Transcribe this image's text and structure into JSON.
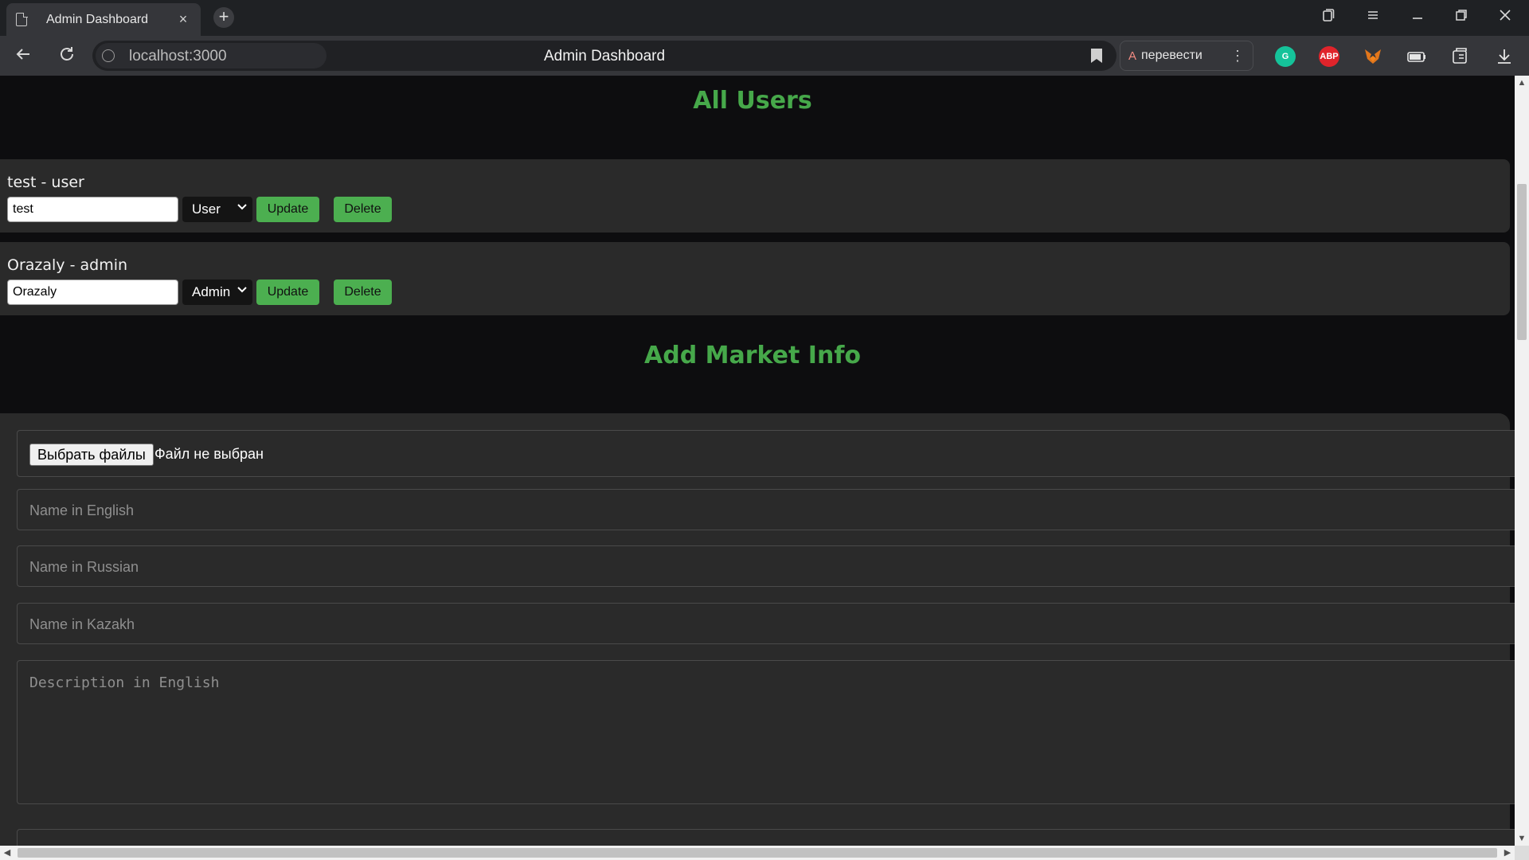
{
  "browser": {
    "tab_title": "Admin Dashboard",
    "tab_close": "×",
    "new_tab": "+",
    "url": "localhost:3000",
    "page_title": "Admin Dashboard",
    "translate_label": "перевести",
    "extensions": [
      "Grammarly",
      "ABP",
      "MetaMask",
      "battery",
      "tabs",
      "downloads"
    ],
    "abp_label": "ABP",
    "grammarly_label": "G"
  },
  "page": {
    "users_title": "All Users",
    "users": [
      {
        "heading": "test - user",
        "name_value": "test",
        "role": "User",
        "update_label": "Update",
        "delete_label": "Delete"
      },
      {
        "heading": "Orazaly - admin",
        "name_value": "Orazaly",
        "role": "Admin",
        "update_label": "Update",
        "delete_label": "Delete"
      }
    ],
    "market_title": "Add Market Info",
    "form": {
      "file_button": "Выбрать файлы",
      "file_status": "Файл не выбран",
      "name_en_placeholder": "Name in English",
      "name_ru_placeholder": "Name in Russian",
      "name_kk_placeholder": "Name in Kazakh",
      "desc_en_placeholder": "Description in English"
    }
  },
  "colors": {
    "accent_green": "#4caf50",
    "title_green": "#46a84a",
    "page_bg": "#0d0d0f",
    "card_bg": "#2a2a2a"
  }
}
